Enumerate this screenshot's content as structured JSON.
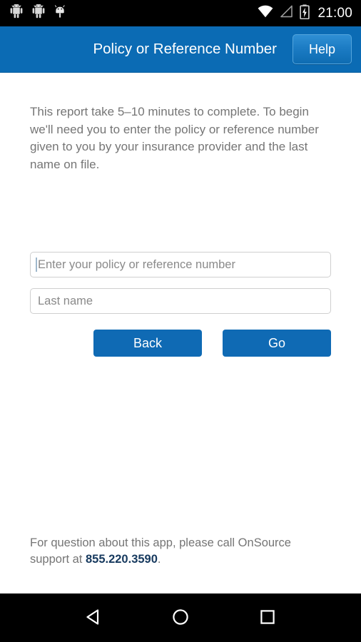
{
  "status_bar": {
    "notification_icons": [
      "android-robot-icon",
      "android-robot-icon",
      "android-robot-head-icon"
    ],
    "wifi_icon": "wifi-icon",
    "signal_icon": "cell-signal-icon",
    "battery_icon": "battery-charging-icon",
    "time": "21:00"
  },
  "app_bar": {
    "title": "Policy or Reference Number",
    "help_label": "Help",
    "background_color": "#0b6bb4"
  },
  "content": {
    "intro_text": "This report take 5–10 minutes to complete. To begin we'll need you to enter the policy or reference number given to you by your insurance provider and the last name on file.",
    "fields": [
      {
        "name": "policy-number",
        "value": "",
        "placeholder": "Enter your policy or reference number"
      },
      {
        "name": "last-name",
        "value": "",
        "placeholder": "Last name"
      }
    ],
    "buttons": {
      "back_label": "Back",
      "go_label": "Go",
      "color": "#0f6ab4"
    },
    "footer": {
      "text_before": "For question about this app, please call OnSource support at ",
      "phone": "855.220.3590",
      "text_after": ".",
      "phone_color": "#16395e"
    }
  },
  "nav_bar": {
    "back_icon": "nav-back-triangle-icon",
    "home_icon": "nav-home-circle-icon",
    "recents_icon": "nav-recents-square-icon"
  }
}
